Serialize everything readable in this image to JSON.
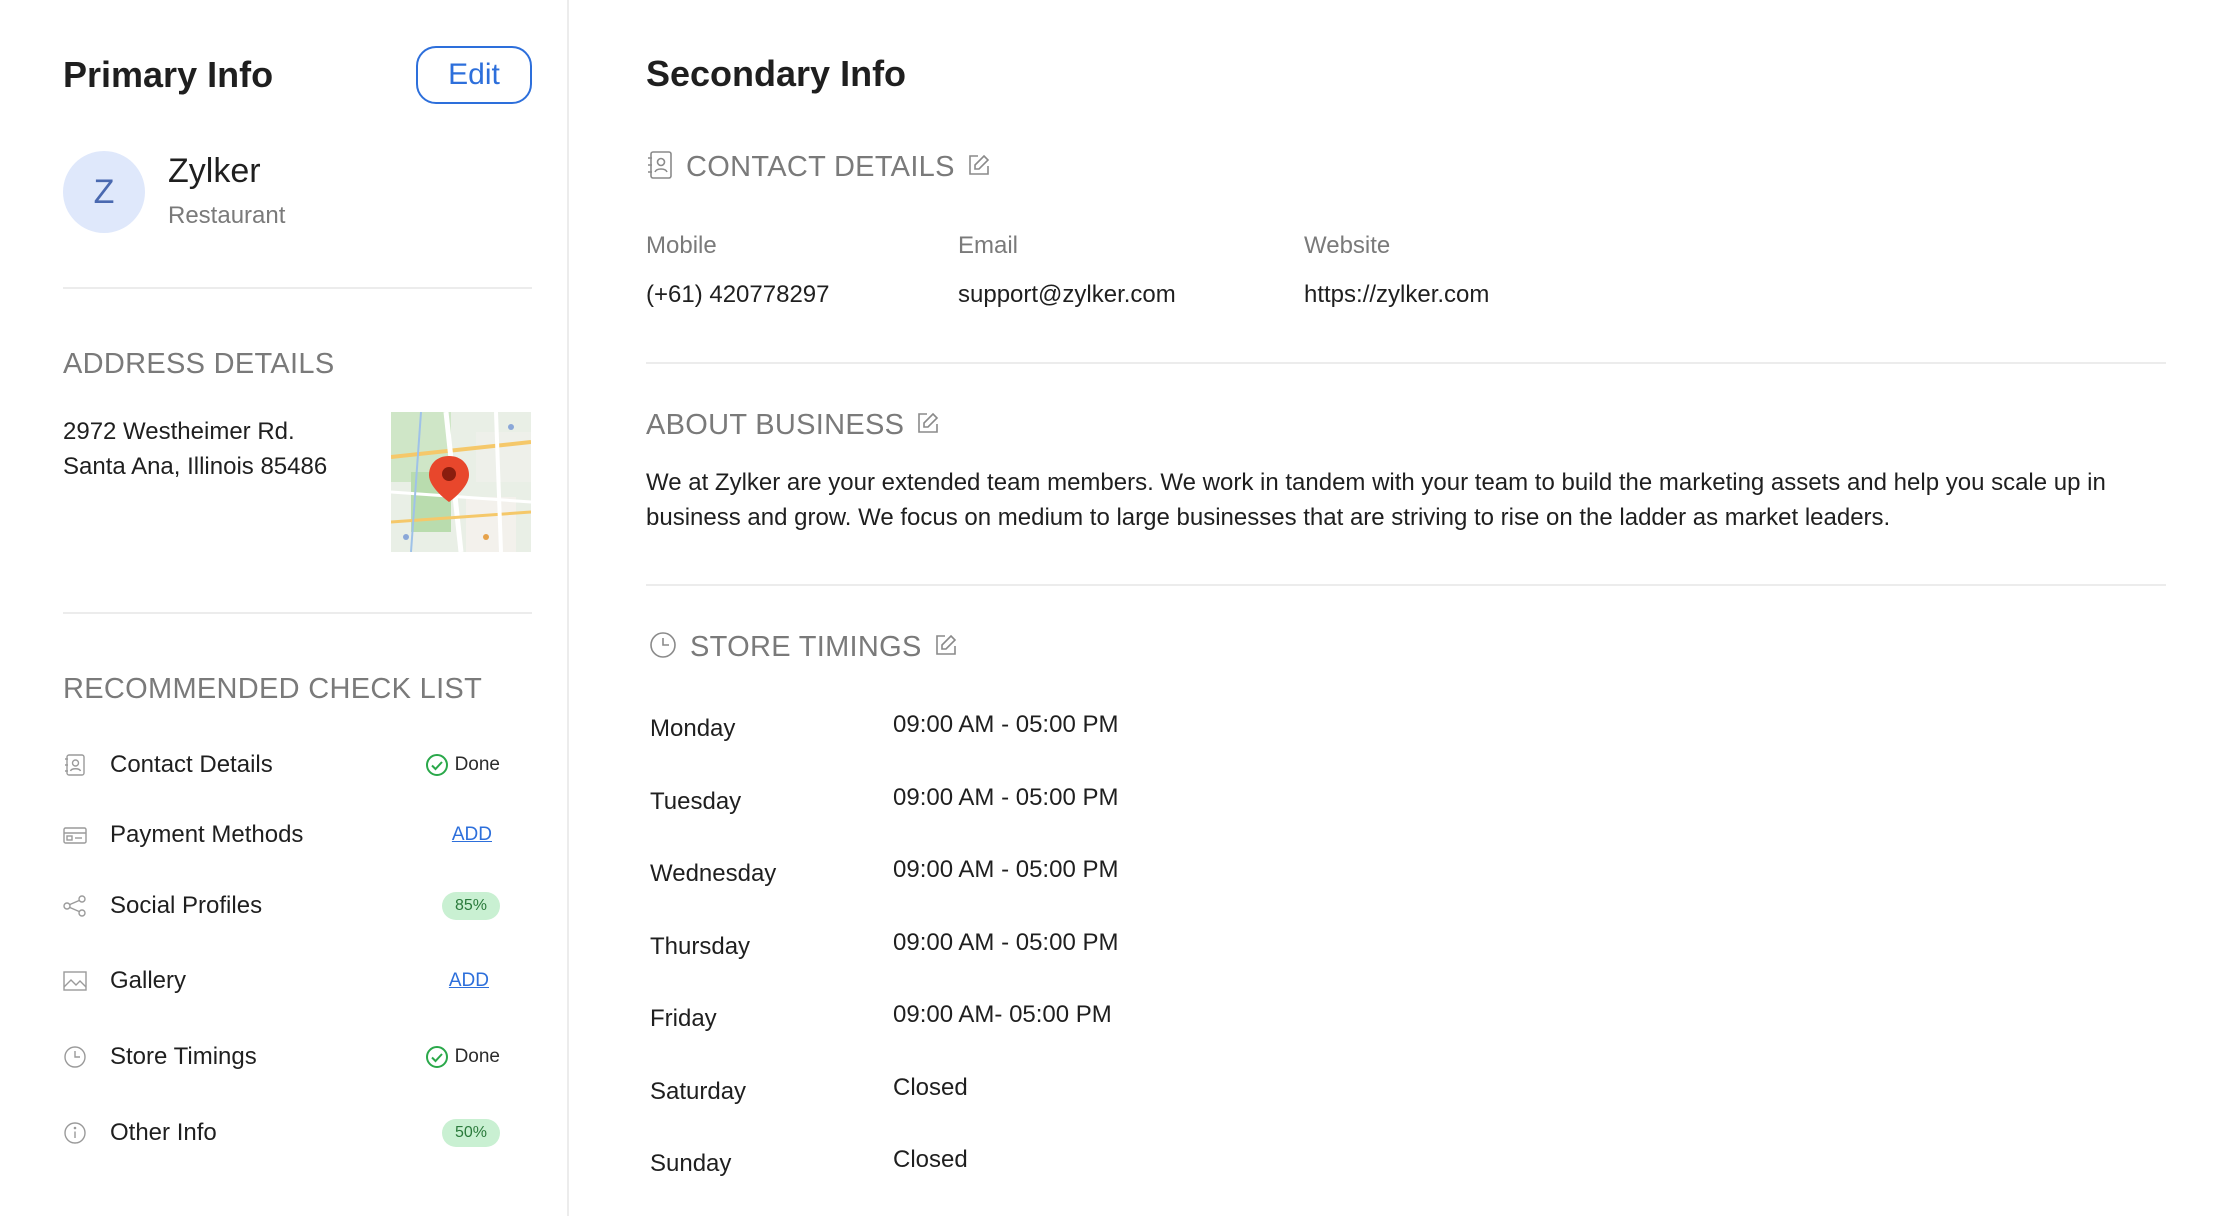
{
  "primary": {
    "title": "Primary Info",
    "edit_label": "Edit",
    "avatar_initial": "Z",
    "business_name": "Zylker",
    "business_type": "Restaurant"
  },
  "address": {
    "heading": "ADDRESS DETAILS",
    "line1": "2972 Westheimer Rd.",
    "line2": "Santa Ana, Illinois 85486"
  },
  "checklist": {
    "heading": "RECOMMENDED CHECK LIST",
    "items": [
      {
        "label": "Contact Details",
        "icon": "contact-card-icon",
        "status_type": "done",
        "status": "Done"
      },
      {
        "label": "Payment Methods",
        "icon": "payment-card-icon",
        "status_type": "add",
        "status": "ADD"
      },
      {
        "label": "Social Profiles",
        "icon": "share-icon",
        "status_type": "percent",
        "status": "85%",
        "progress": 0.85
      },
      {
        "label": "Gallery",
        "icon": "image-icon",
        "status_type": "add",
        "status": "ADD"
      },
      {
        "label": "Store Timings",
        "icon": "clock-icon",
        "status_type": "done",
        "status": "Done"
      },
      {
        "label": "Other Info",
        "icon": "info-icon",
        "status_type": "percent",
        "status": "50%",
        "progress": 0.5
      }
    ]
  },
  "secondary": {
    "title": "Secondary Info",
    "contact": {
      "heading": "CONTACT DETAILS",
      "mobile_label": "Mobile",
      "mobile": "(+61) 420778297",
      "email_label": "Email",
      "email": "support@zylker.com",
      "website_label": "Website",
      "website": "https://zylker.com"
    },
    "about": {
      "heading": "ABOUT BUSINESS",
      "text": "We at Zylker are your extended team members. We work in tandem with your team to build the marketing assets and help you scale up in business and grow. We focus on medium to large businesses that are striving to rise on the ladder as market leaders."
    },
    "timings": {
      "heading": "STORE TIMINGS",
      "days": [
        {
          "day": "Monday",
          "time": "09:00 AM - 05:00 PM"
        },
        {
          "day": "Tuesday",
          "time": "09:00 AM - 05:00 PM"
        },
        {
          "day": "Wednesday",
          "time": "09:00 AM - 05:00 PM"
        },
        {
          "day": "Thursday",
          "time": "09:00 AM - 05:00 PM"
        },
        {
          "day": "Friday",
          "time": "09:00 AM- 05:00 PM"
        },
        {
          "day": "Saturday",
          "time": "Closed"
        },
        {
          "day": "Sunday",
          "time": "Closed"
        }
      ]
    }
  },
  "colors": {
    "accent": "#2d6fdb",
    "avatar_bg": "#dfe8fb",
    "done_green": "#2aa84a",
    "pill_bg": "#c9f0d2",
    "map_pin": "#e8472c"
  }
}
